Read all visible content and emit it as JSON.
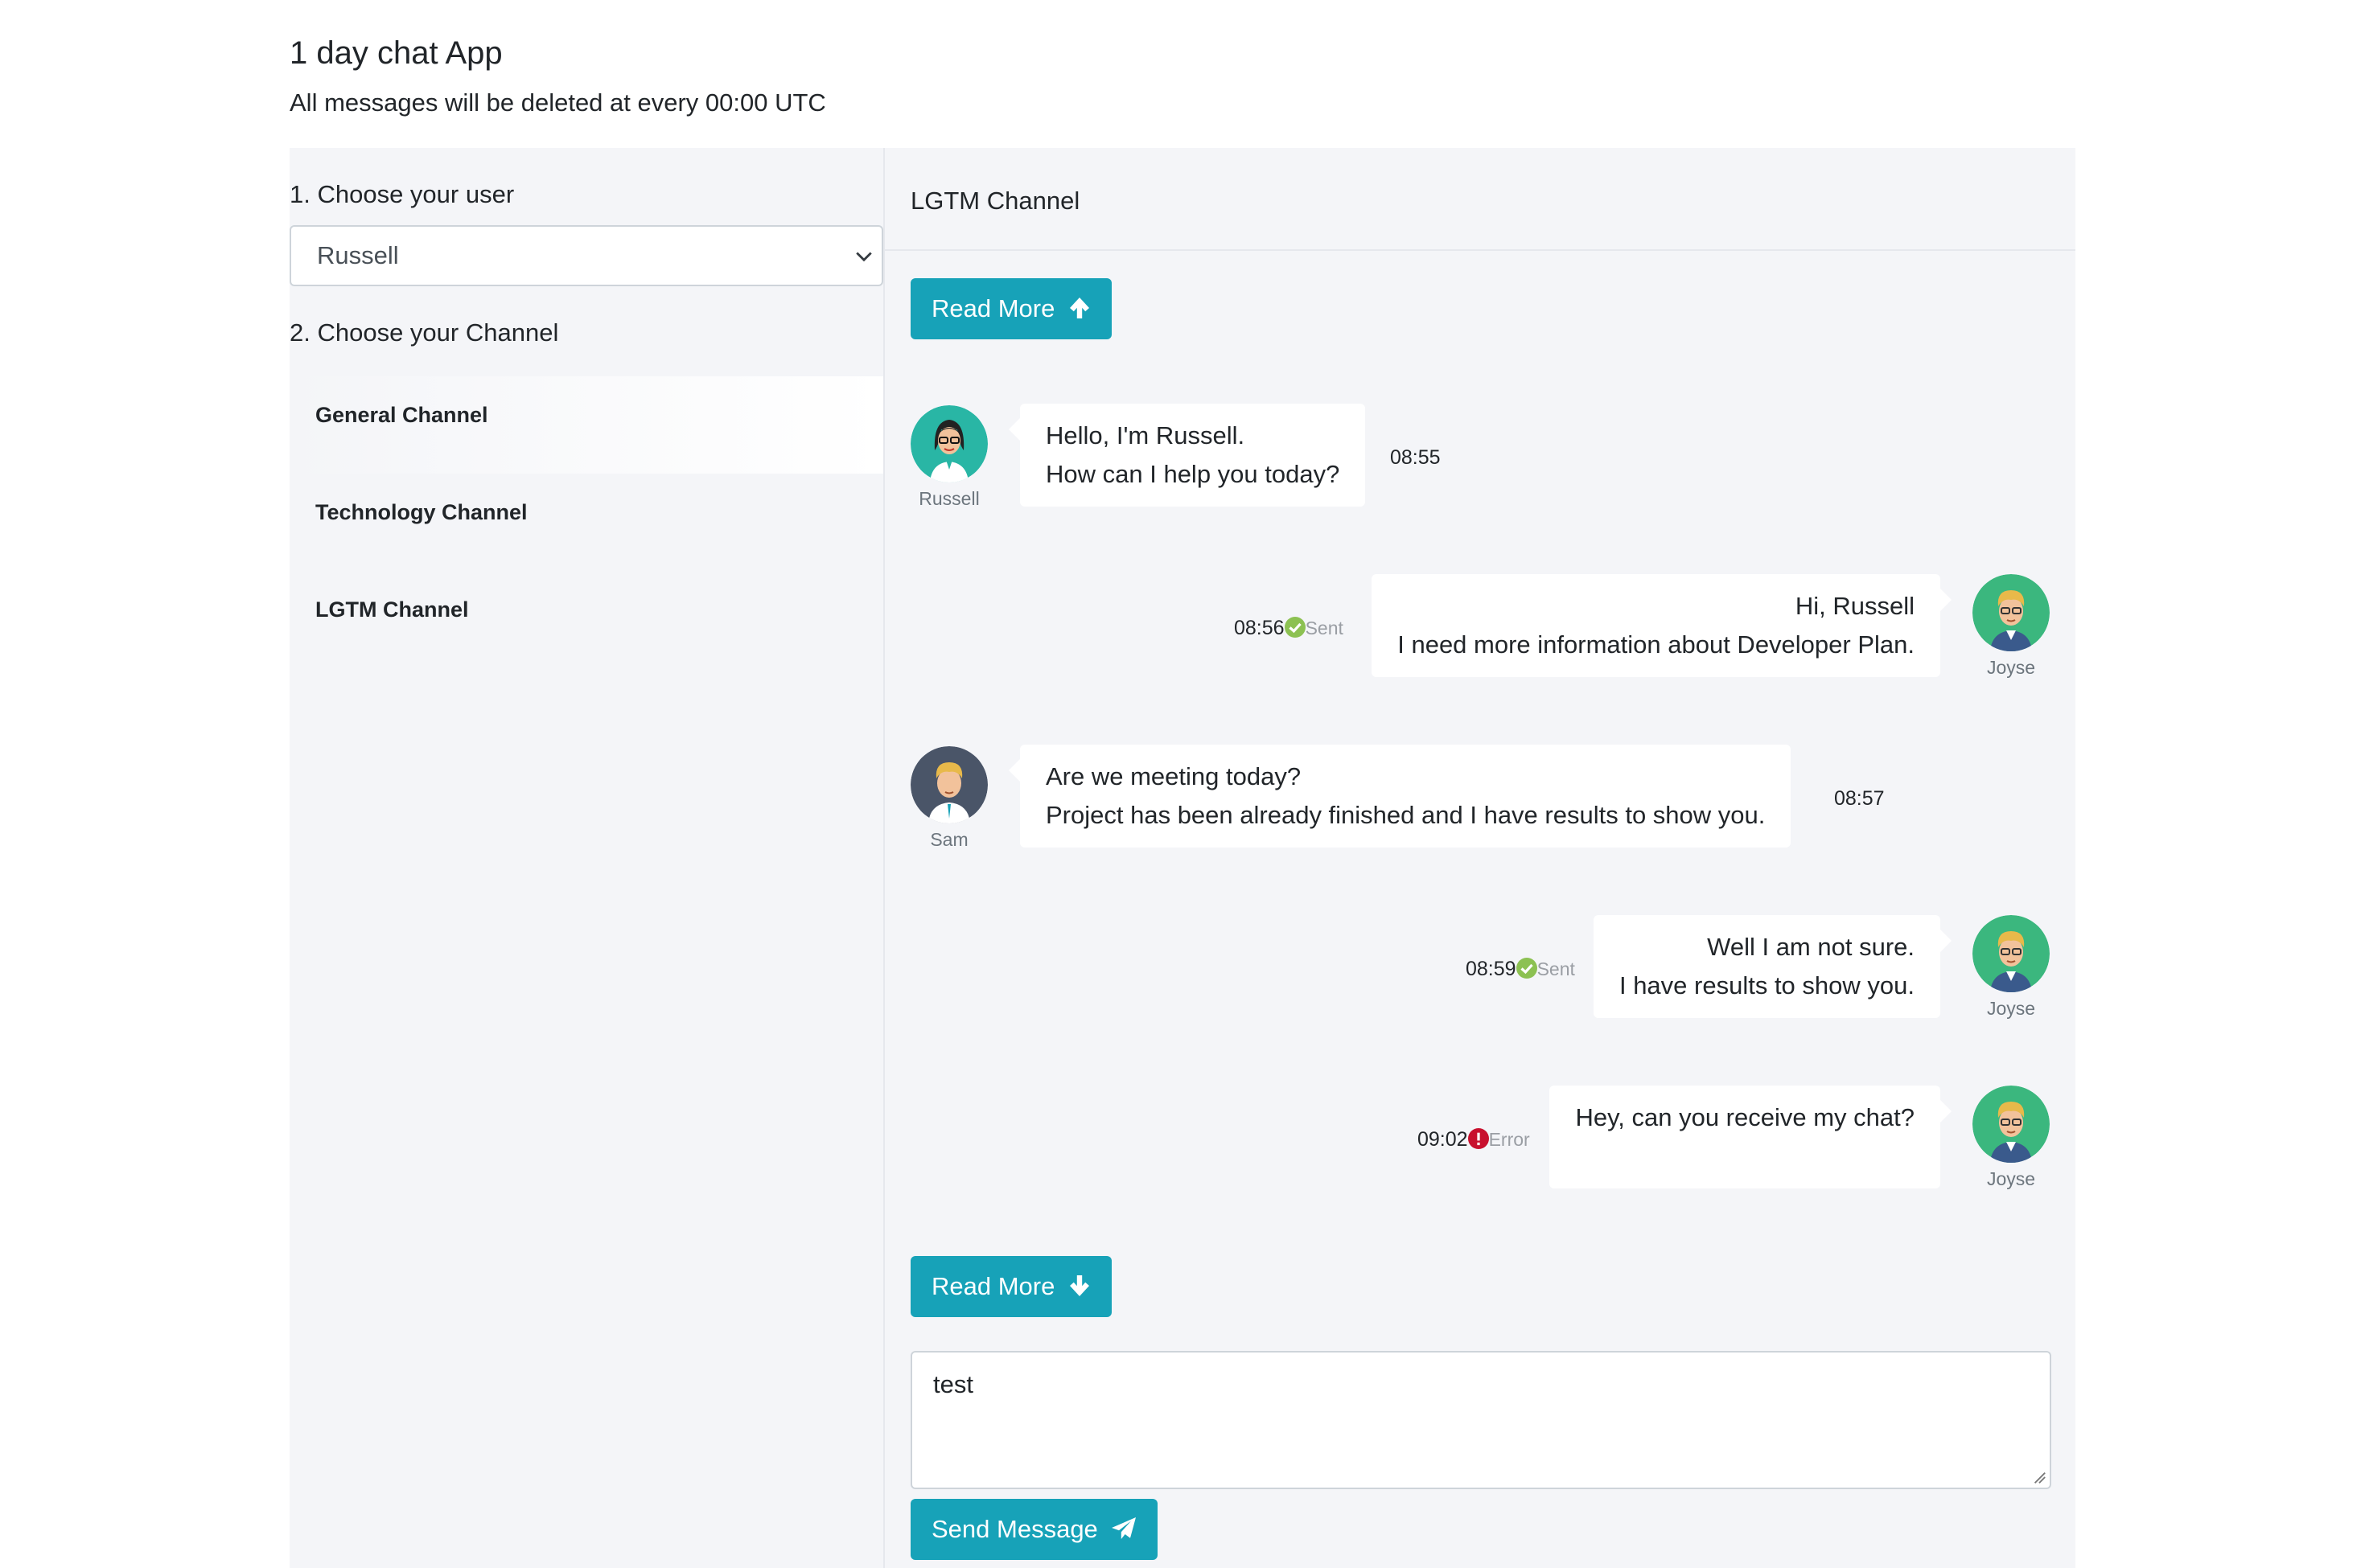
{
  "app": {
    "title": "1 day chat App",
    "subtitle": "All messages will be deleted at every 00:00 UTC"
  },
  "sidebar": {
    "choose_user_label": "1. Choose your user",
    "selected_user": "Russell",
    "choose_channel_label": "2. Choose your Channel",
    "channels": [
      {
        "label": "General Channel",
        "active": true
      },
      {
        "label": "Technology Channel",
        "active": false
      },
      {
        "label": "LGTM Channel",
        "active": false
      }
    ]
  },
  "chat": {
    "channel_title": "LGTM Channel",
    "read_more_top": "Read More",
    "read_more_bottom": "Read More",
    "messages": [
      {
        "side": "left",
        "author": "Russell",
        "lines": [
          "Hello, I'm Russell.",
          "How can I help you today?"
        ],
        "time": "08:55",
        "status": ""
      },
      {
        "side": "right",
        "author": "Joyse",
        "lines": [
          "Hi, Russell",
          "I need more information about Developer Plan."
        ],
        "time": "08:56",
        "status": "Sent"
      },
      {
        "side": "left",
        "author": "Sam",
        "lines": [
          "Are we meeting today?",
          "Project has been already finished and I have results to show you."
        ],
        "time": "08:57",
        "status": ""
      },
      {
        "side": "right",
        "author": "Joyse",
        "lines": [
          "Well I am not sure.",
          "I have results to show you."
        ],
        "time": "08:59",
        "status": "Sent"
      },
      {
        "side": "right",
        "author": "Joyse",
        "lines": [
          "Hey, can you receive my chat?",
          ""
        ],
        "time": "09:02",
        "status": "Error"
      }
    ],
    "composer_value": "test",
    "send_label": "Send Message"
  },
  "colors": {
    "accent": "#17a2b8",
    "panel_bg": "#f4f5f8",
    "sent_green": "#8cc152",
    "error_red": "#c8102e"
  }
}
